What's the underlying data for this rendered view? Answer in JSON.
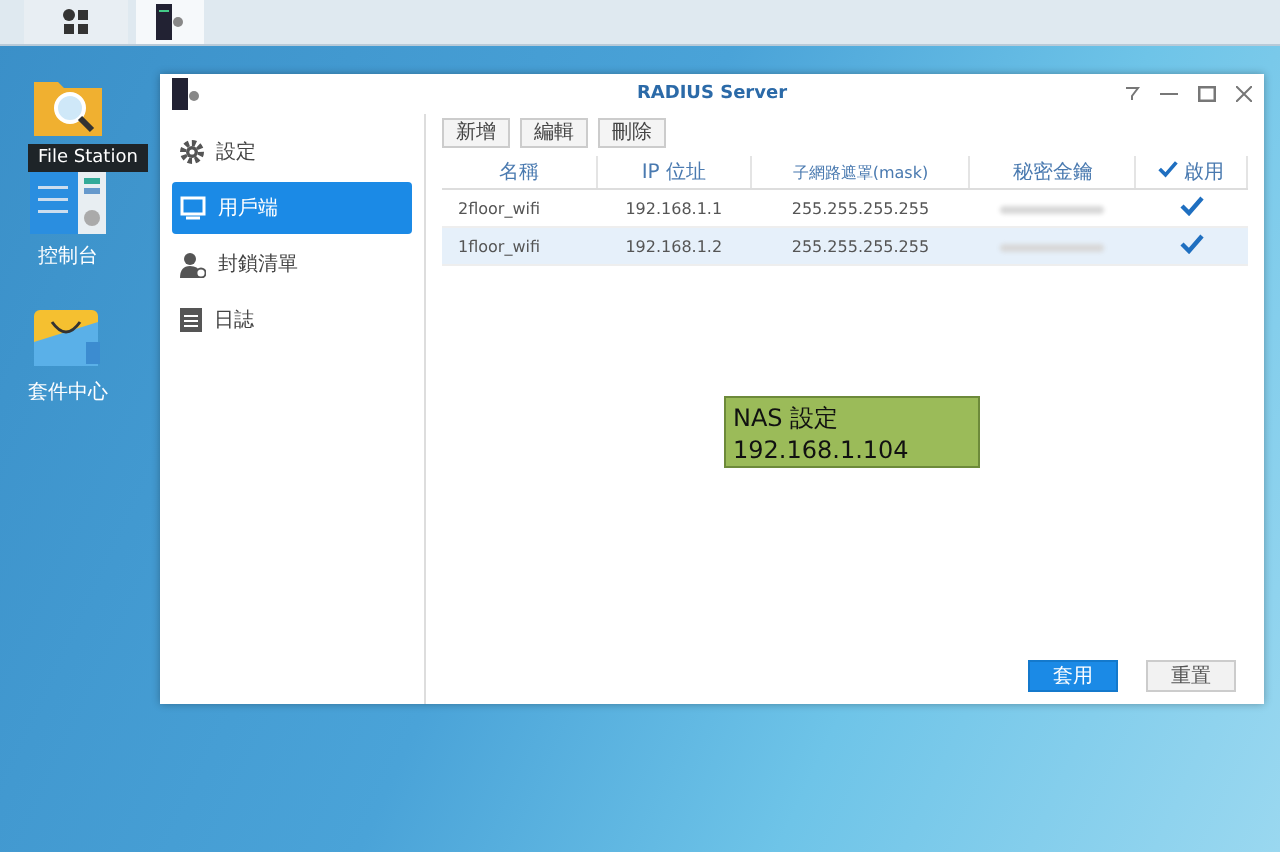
{
  "taskbar": {
    "items": [
      {
        "kind": "grid",
        "selected": false
      },
      {
        "kind": "app",
        "selected": true
      }
    ]
  },
  "desktop": {
    "icons": [
      {
        "kind": "folder"
      },
      {
        "kind": "panel",
        "label": "控制台"
      },
      {
        "kind": "bag",
        "label": "套件中心"
      }
    ],
    "tooltip": "File Station"
  },
  "window": {
    "title": "RADIUS Server",
    "sidebar": {
      "items": [
        {
          "kind": "gear",
          "label": "設定",
          "selected": false
        },
        {
          "kind": "monitor",
          "label": "用戶端",
          "selected": true
        },
        {
          "kind": "user",
          "label": "封鎖清單",
          "selected": false
        },
        {
          "kind": "list",
          "label": "日誌",
          "selected": false
        }
      ]
    },
    "toolbar": [
      "新增",
      "編輯",
      "刪除"
    ],
    "table": {
      "columns": [
        "名稱",
        "IP 位址",
        "子網路遮罩(mask)",
        "秘密金鑰",
        "啟用"
      ],
      "enable_all_checked": true,
      "rows": [
        {
          "name": "2floor_wifi",
          "ip": "192.168.1.1",
          "mask": "255.255.255.255",
          "enabled": true,
          "selected": false
        },
        {
          "name": "1floor_wifi",
          "ip": "192.168.1.2",
          "mask": "255.255.255.255",
          "enabled": true,
          "selected": true
        }
      ]
    },
    "note": {
      "lines": [
        "NAS 設定",
        "192.168.1.104"
      ]
    },
    "buttons": [
      {
        "kind": "primary",
        "label": "套用"
      },
      {
        "kind": "default",
        "label": "重置"
      }
    ]
  }
}
